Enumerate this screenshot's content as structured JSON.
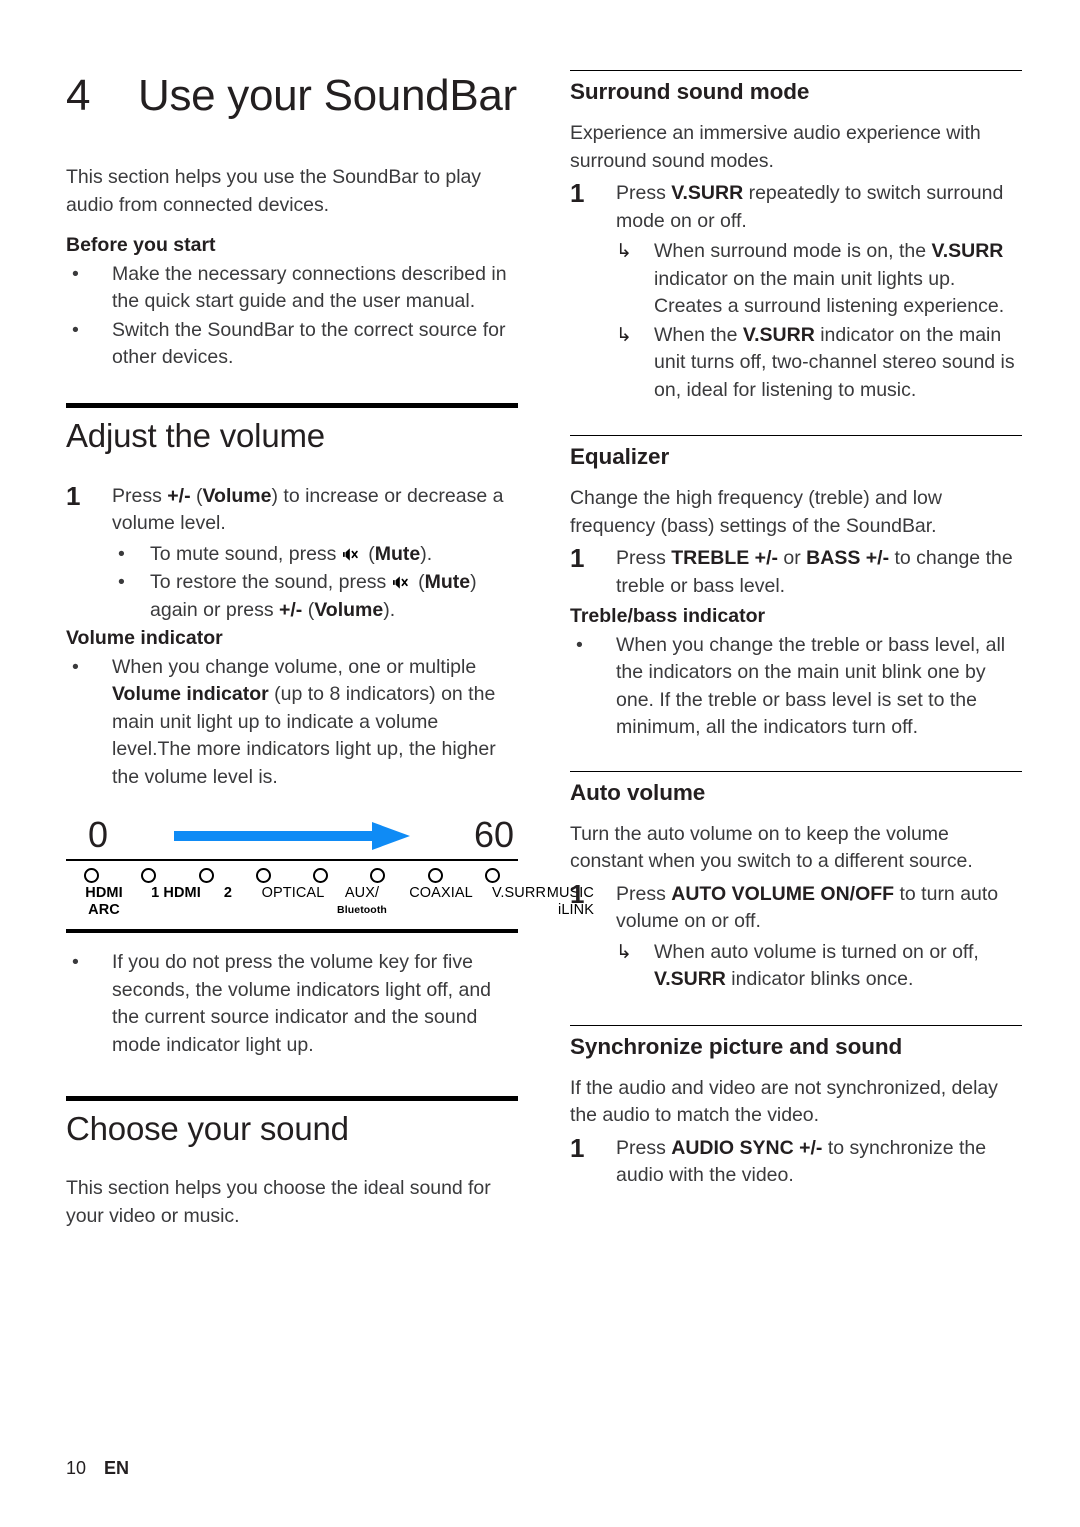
{
  "document": {
    "chapter_number": "4",
    "chapter_title": "Use your SoundBar",
    "footer_page": "10",
    "footer_lang": "EN",
    "accent_color": "#0f8bf5"
  },
  "left_column": {
    "intro": "This section helps you use the SoundBar to play audio from connected devices.",
    "before_you_start": {
      "heading": "Before you start",
      "bullets": [
        "Make the necessary connections described in the quick start guide and the user manual.",
        "Switch the SoundBar to the correct source for other devices."
      ]
    },
    "adjust_volume": {
      "heading": "Adjust the volume",
      "step1_num": "1",
      "step1_text_a": "Press ",
      "step1_bold_a": "+/-",
      "step1_text_b": " (",
      "step1_bold_b": "Volume",
      "step1_text_c": ") to increase or decrease a volume level.",
      "sub_bullets": [
        {
          "pre": "To mute sound, press ",
          "icon": "mute-icon",
          "mid": " (",
          "bold": "Mute",
          "post": ")."
        },
        {
          "pre": "To restore the sound, press ",
          "icon": "mute-icon",
          "mid": " (",
          "bold": "Mute",
          "post": ") again or press ",
          "bold2": "+/-",
          "post2": " (",
          "bold3": "Volume",
          "post3": ")."
        }
      ],
      "volume_indicator_heading": "Volume indicator",
      "volume_indicator_bullet_a": "When you change volume, one or multiple ",
      "volume_indicator_bullet_bold": "Volume indicator",
      "volume_indicator_bullet_b": " (up to 8 indicators) on the main unit light up to indicate a volume level.The more indicators light up, the higher the volume level is.",
      "after_figure_bullet": "If you do not press the volume key for five seconds, the volume indicators light off, and the current source indicator and the sound mode indicator light up."
    },
    "volume_figure": {
      "min_label": "0",
      "max_label": "60",
      "arrow": "volume-increase-arrow",
      "indicator_count": 8,
      "indicator_labels": [
        {
          "line1": "HDMI",
          "line2": "ARC",
          "small": ""
        },
        {
          "line1": "1",
          "line2": "HDMI",
          "small": "",
          "inline": "1 HDMI"
        },
        {
          "line1": "2",
          "line2": "",
          "small": ""
        },
        {
          "line1": "OPTICAL",
          "line2": "",
          "small": ""
        },
        {
          "line1": "AUX/",
          "line2": "",
          "small": "Bluetooth"
        },
        {
          "line1": "COAXIAL",
          "line2": "",
          "small": ""
        },
        {
          "line1": "V.SURR",
          "line2": "",
          "small": ""
        },
        {
          "line1": "MUSIC",
          "line2": "iLINK",
          "small": ""
        }
      ]
    },
    "choose_sound": {
      "heading": "Choose your sound",
      "intro": "This section helps you choose the ideal sound for your video or music."
    }
  },
  "right_column": {
    "surround": {
      "heading": "Surround sound mode",
      "intro": "Experience an immersive audio experience with surround sound modes.",
      "step_num": "1",
      "step_pre": "Press ",
      "step_bold": "V.SURR",
      "step_post": " repeatedly to switch surround mode on or off.",
      "arrows": [
        {
          "pre": "When surround mode is on, the ",
          "bold": "V.SURR",
          "post": " indicator on the main unit lights up. Creates a surround listening experience."
        },
        {
          "pre": "When the ",
          "bold": "V.SURR",
          "post": " indicator on the main unit turns off, two-channel stereo sound is on, ideal for listening to music."
        }
      ]
    },
    "equalizer": {
      "heading": "Equalizer",
      "intro": "Change the high frequency (treble) and low frequency (bass) settings of the SoundBar.",
      "step_num": "1",
      "step_pre": "Press ",
      "step_bold1": "TREBLE +/-",
      "step_mid": " or ",
      "step_bold2": "BASS +/-",
      "step_post": " to change the treble or bass level.",
      "sub_heading": "Treble/bass indicator",
      "bullet": "When you change the treble or bass level, all the indicators on the main unit blink one by one. If the treble or bass level is set to the minimum, all the indicators turn off."
    },
    "auto_volume": {
      "heading": "Auto volume",
      "intro": "Turn the auto volume on to keep the volume constant when you switch to a different source.",
      "step_num": "1",
      "step_pre": "Press ",
      "step_bold": "AUTO VOLUME ON/OFF",
      "step_post": " to turn auto volume on or off.",
      "arrow_pre": "When auto volume is turned on or off, ",
      "arrow_bold": "V.SURR",
      "arrow_post": " indicator blinks once."
    },
    "sync": {
      "heading": "Synchronize picture and sound",
      "intro": "If the audio and video are not synchronized, delay the audio to match the video.",
      "step_num": "1",
      "step_pre": "Press ",
      "step_bold": "AUDIO SYNC +/-",
      "step_post": " to synchronize the audio with the video."
    }
  }
}
